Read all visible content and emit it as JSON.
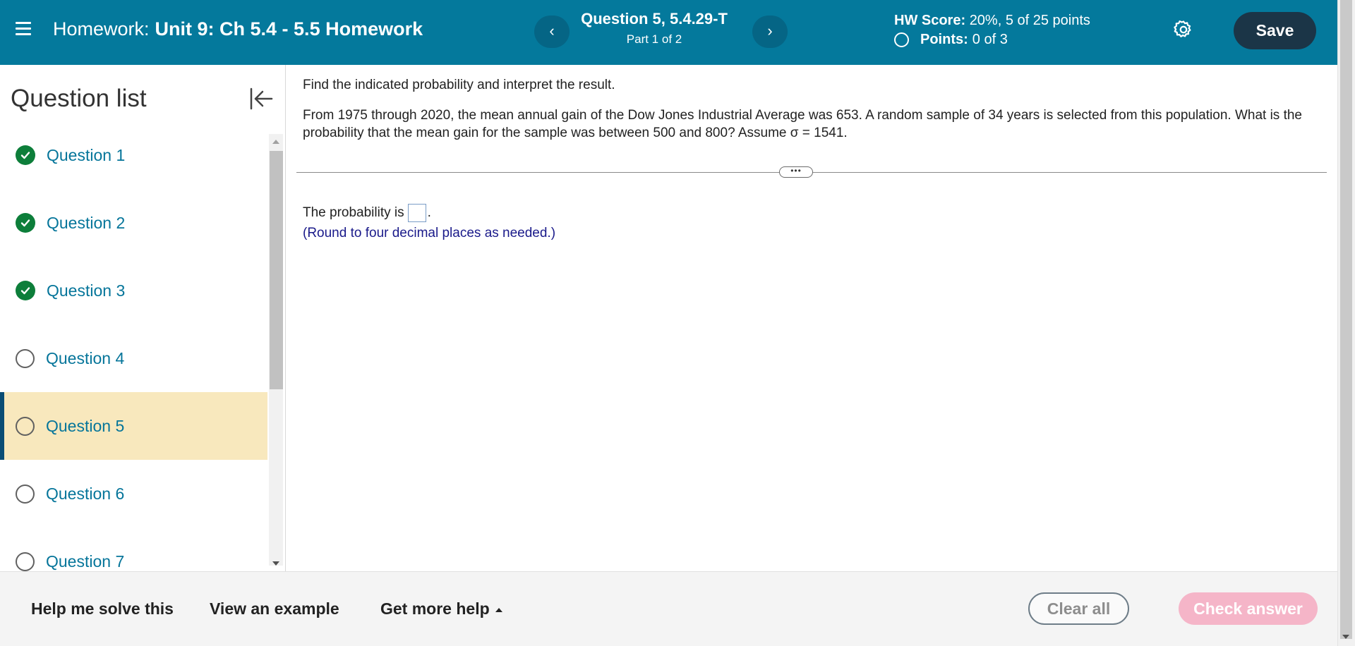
{
  "header": {
    "menu_icon": "hamburger-menu-icon",
    "homework_prefix": "Homework:",
    "homework_name": "Unit 9: Ch 5.4 - 5.5 Homework",
    "question_title": "Question 5, 5.4.29-T",
    "question_part": "Part 1 of 2",
    "prev_icon": "chevron-left-icon",
    "prev_label": "‹",
    "next_icon": "chevron-right-icon",
    "next_label": "›",
    "hw_score_label": "HW Score:",
    "hw_score_value": "20%, 5 of 25 points",
    "points_label": "Points:",
    "points_value": "0 of 3",
    "settings_icon": "gear-icon",
    "save_label": "Save",
    "colors": {
      "bar": "#04799c",
      "save_button": "#1b3547"
    }
  },
  "sidebar": {
    "title": "Question list",
    "collapse_icon": "collapse-left-icon",
    "items": [
      {
        "label": "Question 1",
        "status": "complete",
        "icon": "check-circle-icon"
      },
      {
        "label": "Question 2",
        "status": "complete",
        "icon": "check-circle-icon"
      },
      {
        "label": "Question 3",
        "status": "complete",
        "icon": "check-circle-icon"
      },
      {
        "label": "Question 4",
        "status": "incomplete",
        "icon": "empty-circle-icon"
      },
      {
        "label": "Question 5",
        "status": "incomplete",
        "icon": "empty-circle-icon",
        "active": true
      },
      {
        "label": "Question 6",
        "status": "incomplete",
        "icon": "empty-circle-icon"
      },
      {
        "label": "Question 7",
        "status": "incomplete",
        "icon": "empty-circle-icon"
      }
    ],
    "colors": {
      "active_bg": "#f8e8bd",
      "complete": "#0d7e3a",
      "link": "#05759a"
    }
  },
  "question": {
    "instruction": "Find the indicated probability and interpret the result.",
    "problem": "From 1975 through 2020, the mean annual gain of the Dow Jones Industrial Average was 653. A random sample of 34 years is selected from this population. What is the probability that the mean gain for the sample was between 500 and 800? Assume σ = 1541.",
    "divider_handle": "•••",
    "answer_prefix": "The probability is",
    "answer_value": "",
    "answer_suffix": ".",
    "round_note": "(Round to four decimal places as needed.)"
  },
  "footer": {
    "help_label": "Help me solve this",
    "example_label": "View an example",
    "more_help_label": "Get more help",
    "more_help_icon": "caret-up-icon",
    "clear_label": "Clear all",
    "check_label": "Check answer",
    "colors": {
      "check_button": "#f5b5c8"
    }
  }
}
